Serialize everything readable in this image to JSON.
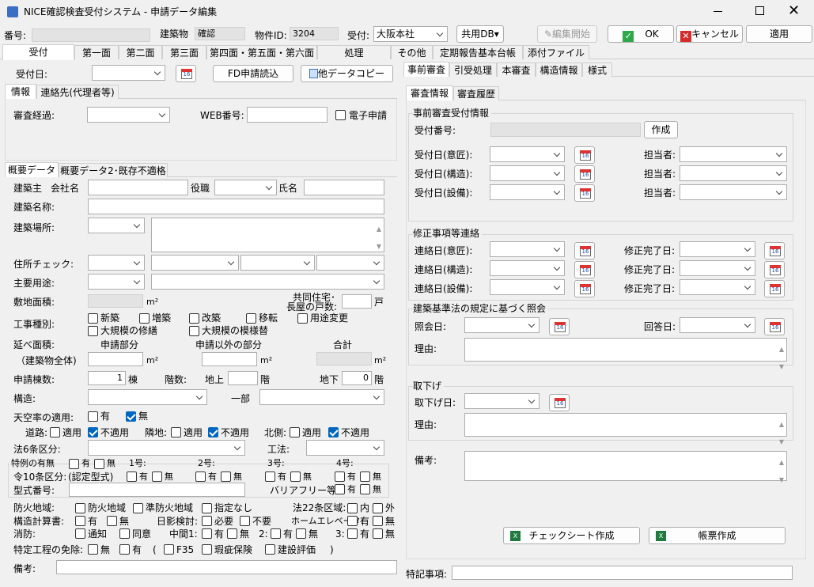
{
  "window": {
    "title": "NICE確認検査受付システム - 申請データ編集"
  },
  "header": {
    "no_label": "番号:",
    "building_label": "建築物",
    "kakunin": "確認",
    "bukken_label": "物件ID:",
    "bukken_id": "3204",
    "uketsuke_label": "受付:",
    "uketsuke_value": "大阪本社",
    "kyoyo_db": "共用DB▾",
    "henshu": "編集開始",
    "ok": "OK",
    "cancel": "キャンセル",
    "apply": "適用"
  },
  "main_tabs": [
    "受付",
    "第一面",
    "第二面",
    "第三面",
    "第四面・第五面・第六面",
    "処理",
    "その他",
    "定期報告基本台帳",
    "添付ファイル"
  ],
  "uketsuke_bi": {
    "label": "受付日:",
    "fd": "FD申請読込",
    "copy": "他データコピー"
  },
  "info_tabs": [
    "情報",
    "連絡先(代理者等)"
  ],
  "info": {
    "keika": "審査経過:",
    "web": "WEB番号:",
    "denshi": "電子申請"
  },
  "gaiyou_tabs": [
    "概要データ",
    "概要データ2･既存不適格"
  ],
  "gaiyou": {
    "kenchikunushi": "建築主",
    "kaisha": "会社名",
    "yakushoku": "役職",
    "shimei": "氏名",
    "meishou": "建築名称:",
    "basho": "建築場所:",
    "jusho_check": "住所チェック:",
    "youto": "主要用途:",
    "shikichi": "敷地面積:",
    "m2": "m²",
    "kyodo1": "共同住宅･",
    "kyodo2": "長屋の戸数:",
    "ko": "戸",
    "shubetsu": "工事種別:",
    "shinchiku": "新築",
    "zouchiku": "増築",
    "kaichiku": "改築",
    "iten": "移転",
    "youto_henkou": "用途変更",
    "dai_shuzen": "大規模の修繕",
    "dai_moyou": "大規模の模様替",
    "nobe": "延べ面積:",
    "shinsei_bubun": "申請部分",
    "igai_bubun": "申請以外の部分",
    "goukei": "合計",
    "zentai": "（建築物全体)",
    "tousu_label": "申請棟数:",
    "tousu": "1",
    "tou": "棟",
    "kaisu": "階数:",
    "chijo": "地上",
    "kai": "階",
    "chika": "地下",
    "chika_val": "0",
    "kouzou": "構造:",
    "ichibu": "一部",
    "tenku": "天空率の適用:",
    "ari": "有",
    "nashi": "無",
    "douro": "道路:",
    "tekiyou": "適用",
    "futekiyou": "不適用",
    "rinchi": "隣地:",
    "kitagawa": "北側:",
    "hou6": "法6条区分:",
    "kouhou": "工法:",
    "tokurei": "特例の有無",
    "go1": "1号:",
    "go2": "2号:",
    "go3": "3号:",
    "go4": "4号:",
    "rei10": "令10条区分:",
    "nintei": "(認定型式)",
    "katashiki": "型式番号:",
    "barrier": "バリアフリー等:",
    "bouka": "防火地域:",
    "bouka1": "防火地域",
    "jun_bouka": "準防火地域",
    "shitei_nashi": "指定なし",
    "hou22": "法22条区域:",
    "uchi": "内",
    "soto": "外",
    "keisan": "構造計算書:",
    "hikage": "日影検討:",
    "hitsuyou": "必要",
    "fuyou": "不要",
    "home": "ホームエレベータ:",
    "shoubou": "消防:",
    "tsuchi": "通知",
    "doui": "同意",
    "chukan1": "中間1:",
    "n2": "2:",
    "n3": "3:",
    "tokutei": "特定工程の免除:",
    "f35": "F35",
    "kashi": "瑕疵保険",
    "kenhyou": "建設評価",
    "paren_open": "(",
    "paren_close": ")",
    "bikou": "備考:"
  },
  "right_tabs": [
    "事前審査",
    "引受処理",
    "本審査",
    "構造情報",
    "様式"
  ],
  "shinsa_tabs": [
    "審査情報",
    "審査履歴"
  ],
  "jizen": {
    "title": "事前審査受付情報",
    "bango": "受付番号:",
    "sakusei": "作成",
    "ishou": "受付日(意匠):",
    "kouzou": "受付日(構造):",
    "setsubi": "受付日(設備):",
    "tantou": "担当者:"
  },
  "shusei": {
    "title": "修正事項等連絡",
    "ishou": "連絡日(意匠):",
    "kouzou": "連絡日(構造):",
    "setsubi": "連絡日(設備):",
    "kanryo": "修正完了日:"
  },
  "shoukai": {
    "title": "建築基準法の規定に基づく照会",
    "shoukai_bi": "照会日:",
    "kaitou_bi": "回答日:",
    "riyu": "理由:"
  },
  "torisage": {
    "title": "取下げ",
    "bi": "取下げ日:",
    "riyu": "理由:"
  },
  "right_bikou": "備考:",
  "check_sheet": "チェックシート作成",
  "chouhyou": "帳票作成",
  "tokki": "特記事項:",
  "colors": {
    "accent": "#0067c0",
    "ok_green": "#2ea84a",
    "cancel_red": "#d62b2b"
  }
}
